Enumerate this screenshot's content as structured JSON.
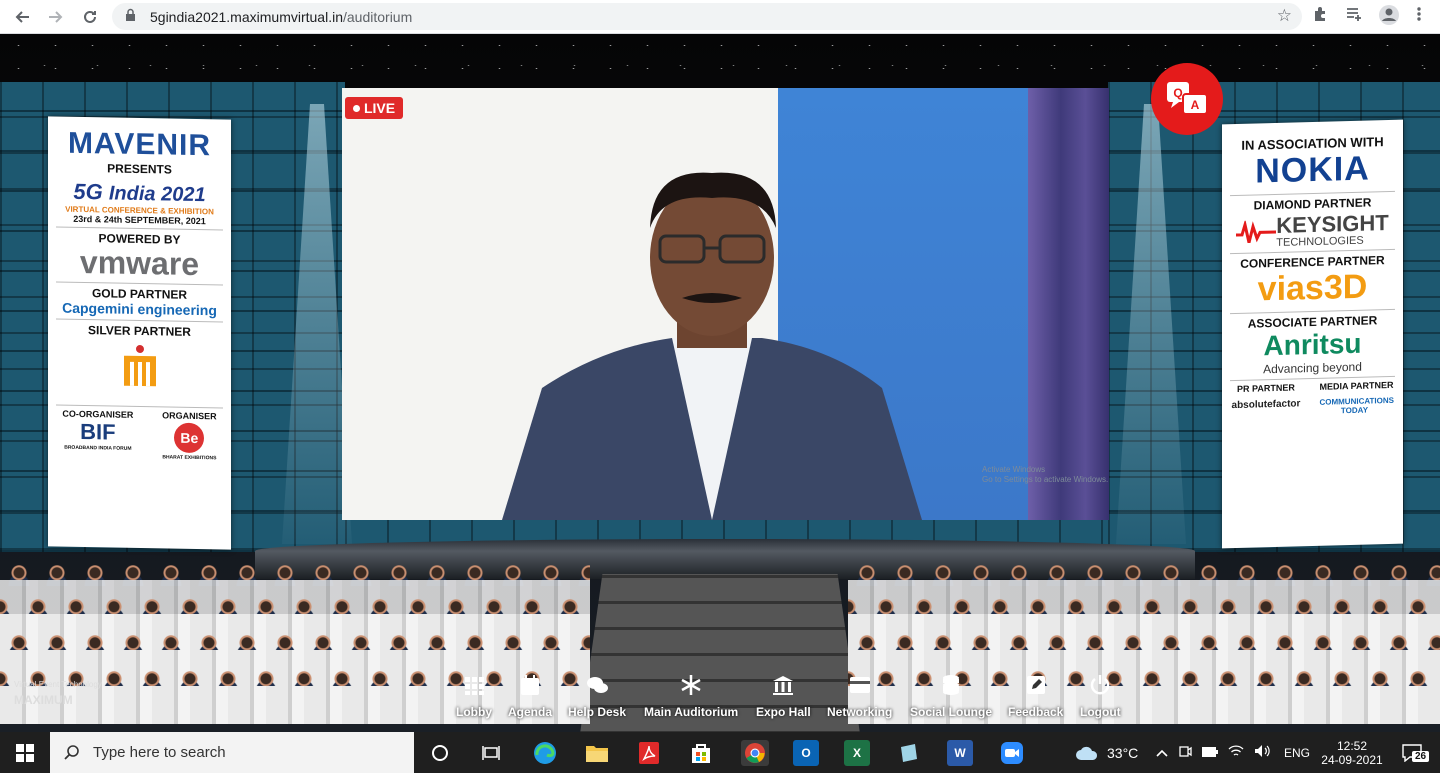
{
  "browser": {
    "url_host": "5gindia2021.maximumvirtual.in",
    "url_path": "/auditorium"
  },
  "stage": {
    "live_label": "LIVE",
    "qa_label": "Q A",
    "activate_line1": "Activate Windows",
    "activate_line2": "Go to Settings to activate Windows."
  },
  "left_banner": {
    "host_brand": "MAVENIR",
    "presents": "PRESENTS",
    "event_5g": "5G",
    "event_name": "India 2021",
    "event_sub": "VIRTUAL CONFERENCE & EXHIBITION",
    "event_dates": "23rd & 24th SEPTEMBER, 2021",
    "powered_by": "POWERED BY",
    "powered_brand": "vmware",
    "gold_partner": "GOLD PARTNER",
    "gold_brand": "Capgemini engineering",
    "silver_partner": "SILVER PARTNER",
    "co_organiser": "CO-ORGANISER",
    "co_brand": "BIF",
    "co_sub": "BROADBAND INDIA FORUM",
    "organiser": "ORGANISER",
    "organiser_brand": "Be",
    "organiser_sub": "BHARAT EXHIBITIONS"
  },
  "right_banner": {
    "association": "IN ASSOCIATION WITH",
    "association_brand": "NOKIA",
    "diamond_partner": "DIAMOND PARTNER",
    "diamond_brand": "KEYSIGHT",
    "diamond_sub": "TECHNOLOGIES",
    "conference_partner": "CONFERENCE PARTNER",
    "conference_brand": "vias3D",
    "associate_partner": "ASSOCIATE PARTNER",
    "associate_brand": "Anritsu",
    "associate_tagline": "Advancing beyond",
    "pr_partner": "PR PARTNER",
    "pr_brand": "absolutefactor",
    "media_partner": "MEDIA PARTNER",
    "media_brand": "COMMUNICATIONS TODAY"
  },
  "watermark": {
    "line1": "Virtual Event Technology",
    "line2": "MAXIMUM"
  },
  "menu": [
    {
      "label": "Lobby",
      "icon": "grid-icon"
    },
    {
      "label": "Agenda",
      "icon": "calendar-icon"
    },
    {
      "label": "Help Desk",
      "icon": "chat-icon"
    },
    {
      "label": "Main Auditorium",
      "icon": "snowflake-icon"
    },
    {
      "label": "Expo Hall",
      "icon": "building-icon"
    },
    {
      "label": "Networking",
      "icon": "card-icon"
    },
    {
      "label": "Social Lounge",
      "icon": "database-icon"
    },
    {
      "label": "Feedback",
      "icon": "edit-icon"
    },
    {
      "label": "Logout",
      "icon": "power-icon"
    }
  ],
  "taskbar": {
    "search_placeholder": "Type here to search",
    "temperature": "33°C",
    "language": "ENG",
    "time": "12:52",
    "date": "24-09-2021",
    "notifications": "26"
  }
}
